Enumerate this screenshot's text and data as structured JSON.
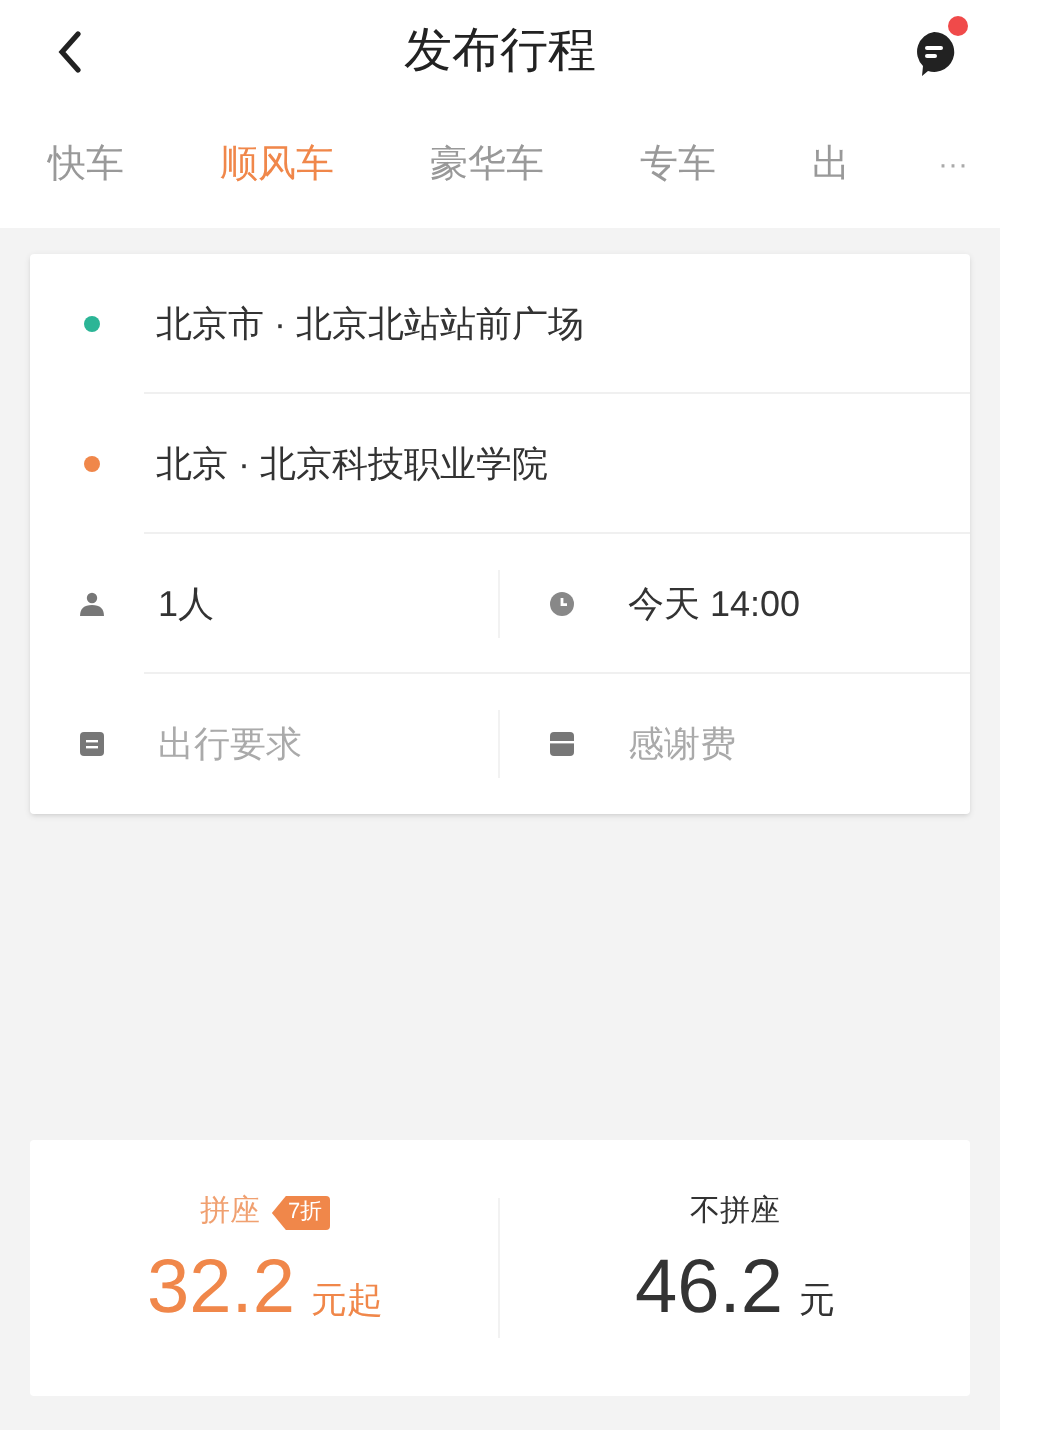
{
  "header": {
    "title": "发布行程",
    "notification": true
  },
  "tabs": [
    {
      "label": "快车",
      "selected": false
    },
    {
      "label": "顺风车",
      "selected": true
    },
    {
      "label": "豪华车",
      "selected": false
    },
    {
      "label": "专车",
      "selected": false
    },
    {
      "label": "出",
      "selected": false
    }
  ],
  "more_tabs": "···",
  "locations": [
    {
      "text": "北京市 · 北京北站站前广场",
      "color": "#2bb596"
    },
    {
      "text": "北京 · 北京科技职业学院",
      "color": "#f0874a"
    }
  ],
  "fields": [
    [
      {
        "value": "1人"
      },
      {
        "value": "今天 14:00"
      }
    ],
    [
      {
        "placeholder": "出行要求"
      },
      {
        "placeholder": "感谢费"
      }
    ]
  ],
  "fares": [
    {
      "label": "拼座",
      "badge": "7折",
      "price": "32.2",
      "unit": "元起",
      "selected": true
    },
    {
      "label": "不拼座",
      "price": "46.2",
      "unit": "元",
      "selected": false
    }
  ]
}
